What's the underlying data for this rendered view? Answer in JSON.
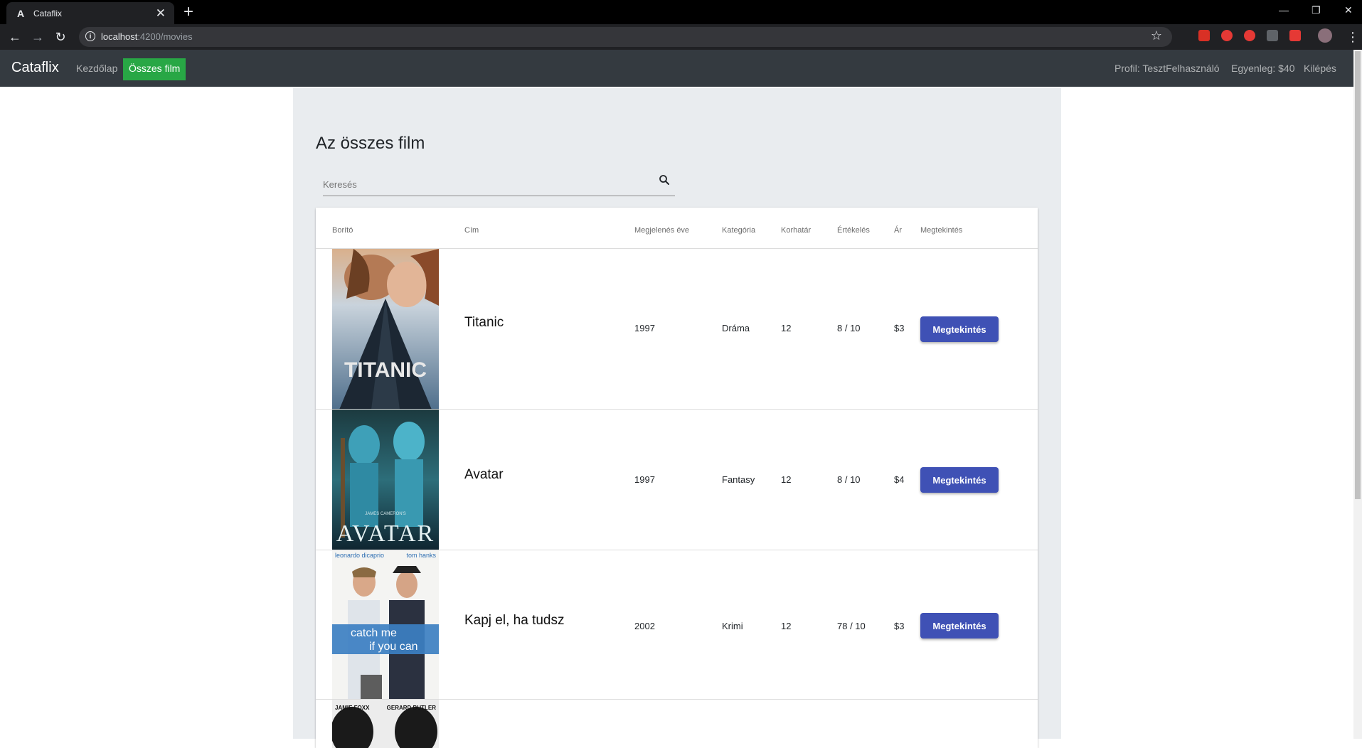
{
  "browser": {
    "tab_title": "Cataflix",
    "tab_favicon": "A",
    "url_host": "localhost",
    "url_path": ":4200/movies"
  },
  "navbar": {
    "brand": "Cataflix",
    "home": "Kezdőlap",
    "all_movies": "Összes film",
    "profile": "Profil: TesztFelhasználó",
    "balance": "Egyenleg: $40",
    "logout": "Kilépés",
    "bg_color": "#343a40",
    "active_color": "#28a745"
  },
  "page": {
    "title": "Az összes film",
    "search_placeholder": "Keresés",
    "search_value": ""
  },
  "table": {
    "headers": [
      "Borító",
      "Cím",
      "Megjelenés éve",
      "Kategória",
      "Korhatár",
      "Értékelés",
      "Ár",
      "Megtekintés"
    ],
    "rows": [
      {
        "title": "Titanic",
        "year": "1997",
        "category": "Dráma",
        "age": "12",
        "rating": "8 / 10",
        "price": "$3",
        "action": "Megtekintés",
        "poster_text": "TITANIC"
      },
      {
        "title": "Avatar",
        "year": "1997",
        "category": "Fantasy",
        "age": "12",
        "rating": "8 / 10",
        "price": "$4",
        "action": "Megtekintés",
        "poster_text": "AVATAR",
        "poster_top_text": "JAMES CAMERON'S"
      },
      {
        "title": "Kapj el, ha tudsz",
        "year": "2002",
        "category": "Krimi",
        "age": "12",
        "rating": "78 / 10",
        "price": "$3",
        "action": "Megtekintés",
        "poster_text": "catch me",
        "poster_text2": "if you can",
        "poster_top_left": "leonardo dicaprio",
        "poster_top_right": "tom hanks"
      },
      {
        "poster_top_left": "JAMIE FOXX",
        "poster_top_right": "GERARD BUTLER"
      }
    ],
    "button_color": "#3f51b5"
  }
}
